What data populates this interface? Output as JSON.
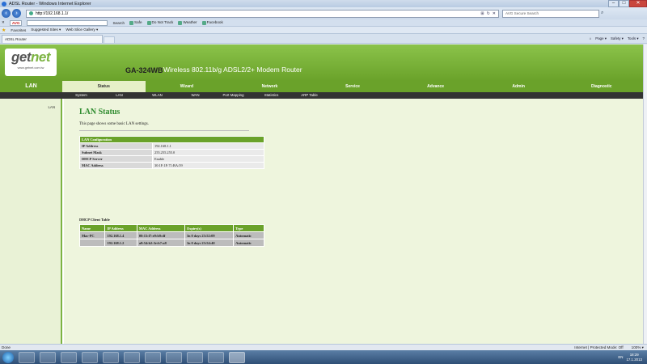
{
  "window": {
    "title": "ADSL Router - Windows Internet Explorer",
    "minimize": "–",
    "maximize": "□",
    "close": "✕"
  },
  "addressbar": {
    "url": "http://192.168.1.1/",
    "search_placeholder": "AVG Secure Search"
  },
  "toolbar": {
    "avg_label": "AVG",
    "search_label": "Search",
    "items": [
      "Safe",
      "Do Not Track",
      "Weather",
      "Facebook"
    ]
  },
  "favorites": {
    "label": "Favorites",
    "items": [
      "Suggested Sites ▾",
      "Web Slice Gallery ▾"
    ]
  },
  "tab": {
    "label": "ADSL Router"
  },
  "commandbar": [
    "Page ▾",
    "Safety ▾",
    "Tools ▾"
  ],
  "router": {
    "brand_get": "get",
    "brand_net": "net",
    "brand_url": "www.getnet.com.tw",
    "model": "GA-324WB",
    "tagline": "Wireless 802.11b/g ADSL2/2+ Modem Router",
    "section": "LAN",
    "main_nav": [
      "Status",
      "Wizard",
      "Network",
      "Service",
      "Advance",
      "Admin",
      "Diagnostic"
    ],
    "sub_nav": [
      "System",
      "LAN",
      "WLAN",
      "WAN",
      "Port Mapping",
      "Statistics",
      "ARP Table"
    ],
    "left_link": "LAN",
    "page_title": "LAN Status",
    "description": "This page shows some basic LAN settings.",
    "config": {
      "header": "LAN Configuration",
      "rows": [
        {
          "key": "IP Address",
          "value": "192.168.1.1"
        },
        {
          "key": "Subnet Mask",
          "value": "255.255.255.0"
        },
        {
          "key": "DHCP Server",
          "value": "Enable"
        },
        {
          "key": "MAC Address",
          "value": "30:1F:1F:71:BA:59"
        }
      ]
    },
    "dhcp": {
      "title": "DHCP Client Table",
      "headers": [
        "Name",
        "IP Address",
        "MAC Address",
        "Expiry(s)",
        "Type"
      ],
      "rows": [
        [
          "Mac-PC",
          "192.168.1.4",
          "00:15:f7:e9:b9:df",
          "In 0 days 23:52:09",
          "Automatic"
        ],
        [
          "",
          "192.168.1.2",
          "a8:54:b2:3e:b7:a8",
          "In 0 days 23:54:40",
          "Automatic"
        ]
      ]
    }
  },
  "statusbar": {
    "left": "Done",
    "zone": "Internet | Protected Mode: Off",
    "zoom": "100% ▾"
  },
  "taskbar": {
    "lang": "EN",
    "time": "18:29",
    "date": "17.1.2013"
  }
}
